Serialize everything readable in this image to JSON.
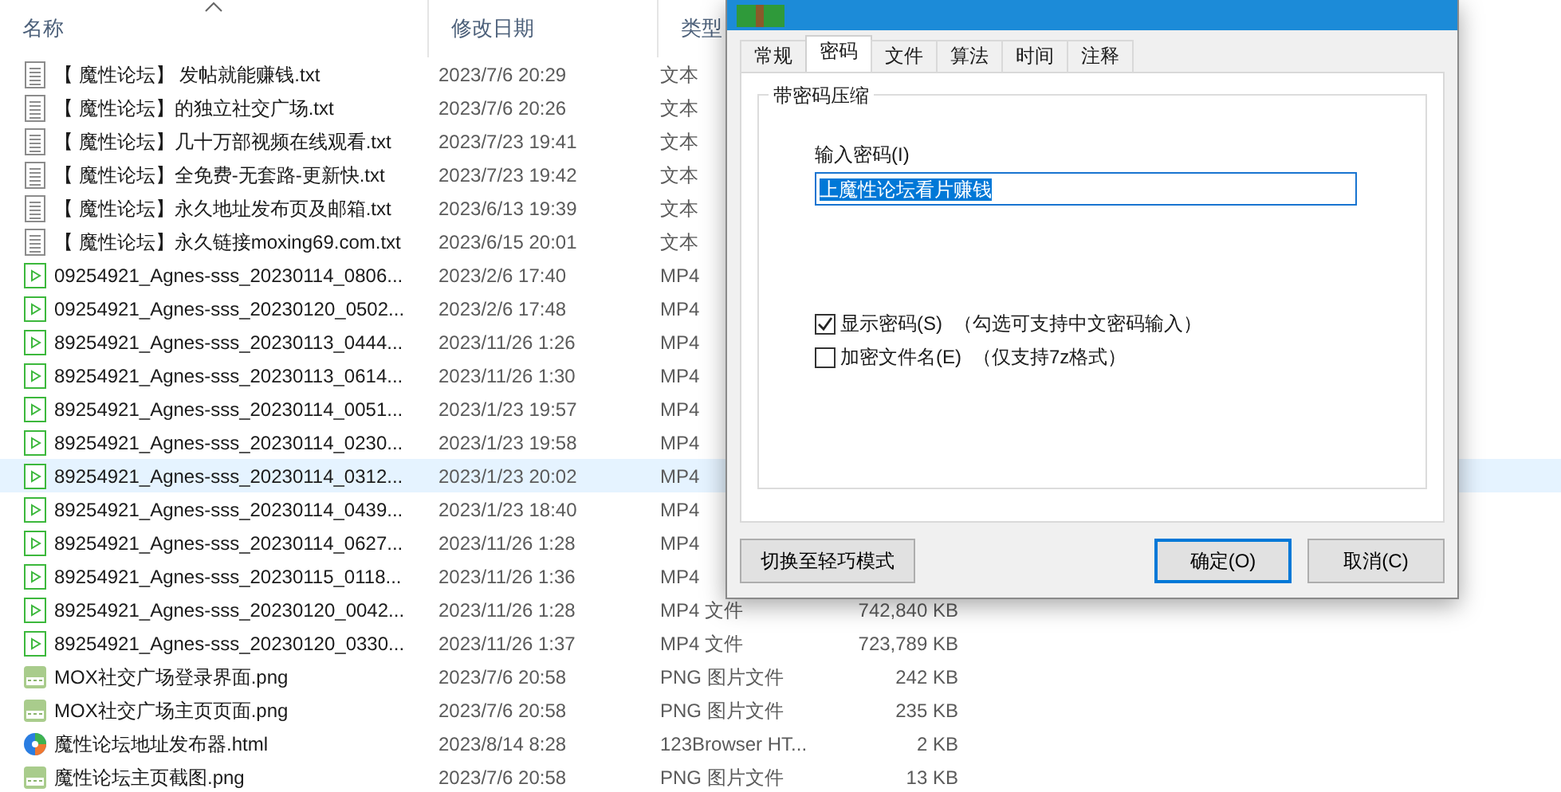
{
  "file_list": {
    "columns": [
      {
        "label": "名称",
        "sorted": true
      },
      {
        "label": "修改日期",
        "sorted": false
      },
      {
        "label": "类型",
        "sorted": false
      }
    ],
    "rows": [
      {
        "kind": "text",
        "name": "【 魔性论坛】 发帖就能赚钱.txt",
        "date": "2023/7/6 20:29",
        "type": "文本",
        "selected": false
      },
      {
        "kind": "text",
        "name": "【 魔性论坛】的独立社交广场.txt",
        "date": "2023/7/6 20:26",
        "type": "文本",
        "selected": false
      },
      {
        "kind": "text",
        "name": "【 魔性论坛】几十万部视频在线观看.txt",
        "date": "2023/7/23 19:41",
        "type": "文本",
        "selected": false
      },
      {
        "kind": "text",
        "name": "【 魔性论坛】全免费-无套路-更新快.txt",
        "date": "2023/7/23 19:42",
        "type": "文本",
        "selected": false
      },
      {
        "kind": "text",
        "name": "【 魔性论坛】永久地址发布页及邮箱.txt",
        "date": "2023/6/13 19:39",
        "type": "文本",
        "selected": false
      },
      {
        "kind": "text",
        "name": "【 魔性论坛】永久链接moxing69.com.txt",
        "date": "2023/6/15 20:01",
        "type": "文本",
        "selected": false
      },
      {
        "kind": "video",
        "name": "09254921_Agnes-sss_20230114_0806...",
        "date": "2023/2/6 17:40",
        "type": "MP4",
        "selected": false
      },
      {
        "kind": "video",
        "name": "09254921_Agnes-sss_20230120_0502...",
        "date": "2023/2/6 17:48",
        "type": "MP4",
        "selected": false
      },
      {
        "kind": "video",
        "name": "89254921_Agnes-sss_20230113_0444...",
        "date": "2023/11/26 1:26",
        "type": "MP4",
        "selected": false
      },
      {
        "kind": "video",
        "name": "89254921_Agnes-sss_20230113_0614...",
        "date": "2023/11/26 1:30",
        "type": "MP4",
        "selected": false
      },
      {
        "kind": "video",
        "name": "89254921_Agnes-sss_20230114_0051...",
        "date": "2023/1/23 19:57",
        "type": "MP4",
        "selected": false
      },
      {
        "kind": "video",
        "name": "89254921_Agnes-sss_20230114_0230...",
        "date": "2023/1/23 19:58",
        "type": "MP4",
        "selected": false
      },
      {
        "kind": "video",
        "name": "89254921_Agnes-sss_20230114_0312...",
        "date": "2023/1/23 20:02",
        "type": "MP4",
        "selected": true
      },
      {
        "kind": "video",
        "name": "89254921_Agnes-sss_20230114_0439...",
        "date": "2023/1/23 18:40",
        "type": "MP4",
        "selected": false
      },
      {
        "kind": "video",
        "name": "89254921_Agnes-sss_20230114_0627...",
        "date": "2023/11/26 1:28",
        "type": "MP4",
        "selected": false
      },
      {
        "kind": "video",
        "name": "89254921_Agnes-sss_20230115_0118...",
        "date": "2023/11/26 1:36",
        "type": "MP4",
        "selected": false
      },
      {
        "kind": "video",
        "name": "89254921_Agnes-sss_20230120_0042...",
        "date": "2023/11/26 1:28",
        "type": "MP4 文件",
        "size": "742,840 KB",
        "selected": false
      },
      {
        "kind": "video",
        "name": "89254921_Agnes-sss_20230120_0330...",
        "date": "2023/11/26 1:37",
        "type": "MP4 文件",
        "size": "723,789 KB",
        "selected": false
      },
      {
        "kind": "image",
        "name": "MOX社交广场登录界面.png",
        "date": "2023/7/6 20:58",
        "type": "PNG 图片文件",
        "size": "242 KB",
        "selected": false
      },
      {
        "kind": "image",
        "name": "MOX社交广场主页页面.png",
        "date": "2023/7/6 20:58",
        "type": "PNG 图片文件",
        "size": "235 KB",
        "selected": false
      },
      {
        "kind": "html",
        "name": "魔性论坛地址发布器.html",
        "date": "2023/8/14 8:28",
        "type": "123Browser HT...",
        "size": "2 KB",
        "selected": false
      },
      {
        "kind": "image",
        "name": "魔性论坛主页截图.png",
        "date": "2023/7/6 20:58",
        "type": "PNG 图片文件",
        "size": "13 KB",
        "selected": false
      }
    ]
  },
  "dialog": {
    "tabs": [
      {
        "label": "常规",
        "selected": false
      },
      {
        "label": "密码",
        "selected": true
      },
      {
        "label": "文件",
        "selected": false
      },
      {
        "label": "算法",
        "selected": false
      },
      {
        "label": "时间",
        "selected": false
      },
      {
        "label": "注释",
        "selected": false
      }
    ],
    "group_title": "带密码压缩",
    "password_label": "输入密码(I)",
    "password_value": "上魔性论坛看片赚钱",
    "options": [
      {
        "label": "显示密码(S)",
        "note": "（勾选可支持中文密码输入）",
        "checked": true
      },
      {
        "label": "加密文件名(E)",
        "note": "（仅支持7z格式）",
        "checked": false
      }
    ],
    "buttons": [
      {
        "label": "切换至轻巧模式",
        "kind": "left",
        "default": false
      },
      {
        "label": "确定(O)",
        "kind": "right",
        "default": true
      },
      {
        "label": "取消(C)",
        "kind": "right",
        "default": false
      }
    ]
  }
}
